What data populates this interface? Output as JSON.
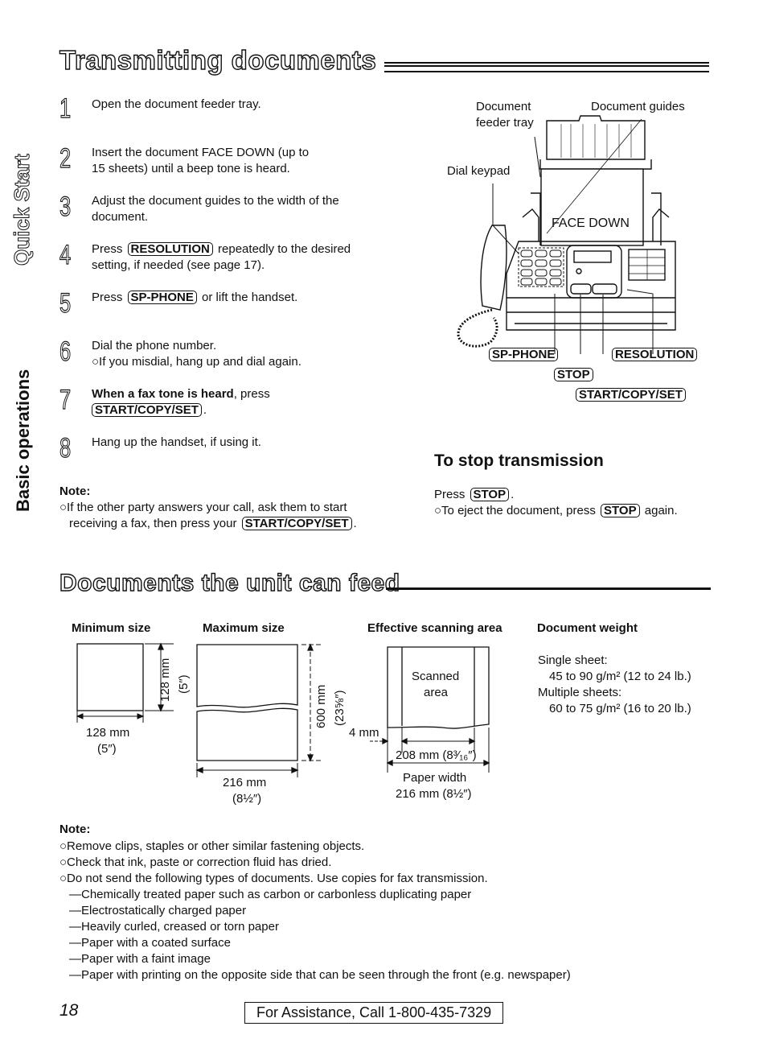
{
  "section1": {
    "title": "Transmitting documents",
    "steps": [
      {
        "num": "1",
        "text": "Open the document feeder tray."
      },
      {
        "num": "2",
        "line1": "Insert the document FACE DOWN (up to",
        "line2": "15 sheets) until a beep tone is heard."
      },
      {
        "num": "3",
        "line1": "Adjust the document guides to the width of the",
        "line2": "document."
      },
      {
        "num": "4",
        "pre": "Press",
        "key": "RESOLUTION",
        "post": "repeatedly to the desired",
        "line2": "setting, if needed (see page 17)."
      },
      {
        "num": "5",
        "pre": "Press",
        "key": "SP-PHONE",
        "post": "or lift the handset."
      },
      {
        "num": "6",
        "line1": "Dial the phone number.",
        "line2": "○If you misdial, hang up and dial again."
      },
      {
        "num": "7",
        "bold": "When a fax tone is heard",
        "post": ", press",
        "key": "START/COPY/SET"
      },
      {
        "num": "8",
        "text": "Hang up the handset, if using it."
      }
    ],
    "note": {
      "label": "Note:",
      "line1": "○If the other party answers your call, ask them to start",
      "line2_pre": "receiving a fax, then press your",
      "line2_key": "START/COPY/SET"
    }
  },
  "side_tabs": {
    "quick_start": "Quick Start",
    "basic_operations": "Basic operations"
  },
  "illustration": {
    "labels": {
      "feeder_tray_1": "Document",
      "feeder_tray_2": "feeder tray",
      "guides": "Document guides",
      "keypad": "Dial keypad",
      "face_down": "FACE DOWN"
    },
    "keys": {
      "sp_phone": "SP-PHONE",
      "resolution": "RESOLUTION",
      "stop": "STOP",
      "start": "START/COPY/SET"
    }
  },
  "stop_section": {
    "title": "To stop transmission",
    "line1_pre": "Press",
    "line1_key": "STOP",
    "line2_pre": "○To eject the document, press",
    "line2_key": "STOP",
    "line2_post": "again."
  },
  "section2": {
    "title": "Documents the unit can feed",
    "min_size": {
      "heading": "Minimum size",
      "height_mm": "128 mm",
      "height_in": "(5″)",
      "width_mm": "128 mm",
      "width_in": "(5″)"
    },
    "max_size": {
      "heading": "Maximum size",
      "height_mm": "600 mm",
      "height_in": "(23⅝″)",
      "width_mm": "216 mm",
      "width_in": "(8½″)"
    },
    "scan_area": {
      "heading": "Effective scanning area",
      "scanned_1": "Scanned",
      "scanned_2": "area",
      "margin": "4 mm",
      "scan_width": "208 mm (8³⁄₁₆″)",
      "paper_width_label": "Paper width",
      "paper_width": "216 mm (8½″)"
    },
    "weight": {
      "heading": "Document weight",
      "single_label": "Single sheet:",
      "single_value": "45 to 90 g/m² (12 to 24 lb.)",
      "multi_label": "Multiple sheets:",
      "multi_value": "60 to 75 g/m² (16 to 20 lb.)"
    },
    "note": {
      "label": "Note:",
      "bullets": [
        "○Remove clips, staples or other similar fastening objects.",
        "○Check that ink, paste or correction fluid has dried.",
        "○Do not send the following types of documents. Use copies for fax transmission."
      ],
      "dashes": [
        "—Chemically treated paper such as carbon or carbonless duplicating paper",
        "—Electrostatically charged paper",
        "—Heavily curled, creased or torn paper",
        "—Paper with a coated surface",
        "—Paper with a faint image",
        "—Paper with printing on the opposite side that can be seen through the front (e.g. newspaper)"
      ]
    }
  },
  "footer": {
    "page_number": "18",
    "assistance": "For Assistance, Call 1-800-435-7329"
  }
}
